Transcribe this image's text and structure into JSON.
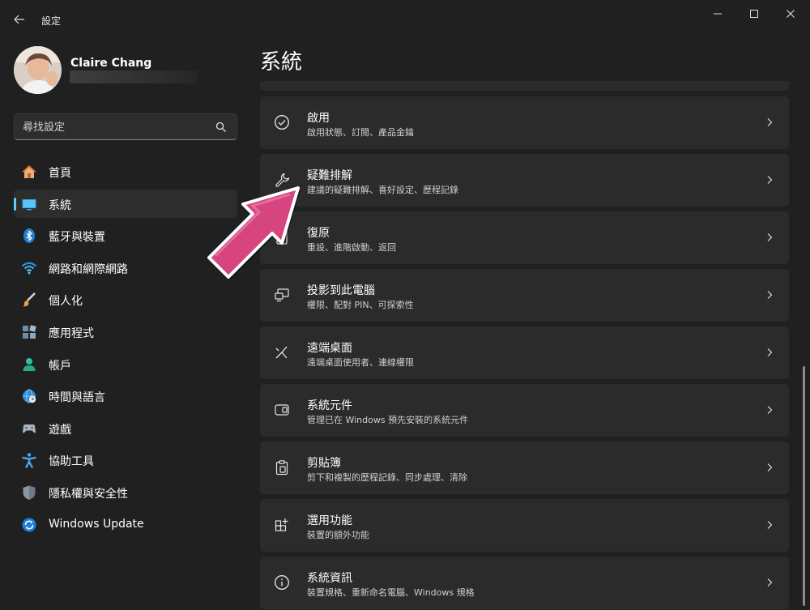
{
  "window": {
    "title": "設定",
    "controls": [
      "minimize-icon",
      "maximize-icon",
      "close-icon"
    ]
  },
  "profile": {
    "name": "Claire Chang"
  },
  "search": {
    "placeholder": "尋找設定"
  },
  "sidebar": {
    "items": [
      {
        "label": "首頁",
        "icon": "home-icon",
        "active": false
      },
      {
        "label": "系統",
        "icon": "monitor-icon",
        "active": true
      },
      {
        "label": "藍牙與裝置",
        "icon": "bluetooth-icon",
        "active": false
      },
      {
        "label": "網路和網際網路",
        "icon": "wifi-icon",
        "active": false
      },
      {
        "label": "個人化",
        "icon": "brush-icon",
        "active": false
      },
      {
        "label": "應用程式",
        "icon": "apps-icon",
        "active": false
      },
      {
        "label": "帳戶",
        "icon": "person-icon",
        "active": false
      },
      {
        "label": "時間與語言",
        "icon": "globe-clock-icon",
        "active": false
      },
      {
        "label": "遊戲",
        "icon": "gamepad-icon",
        "active": false
      },
      {
        "label": "協助工具",
        "icon": "accessibility-icon",
        "active": false
      },
      {
        "label": "隱私權與安全性",
        "icon": "shield-icon",
        "active": false
      },
      {
        "label": "Windows Update",
        "icon": "update-icon",
        "active": false
      }
    ]
  },
  "main": {
    "title": "系統",
    "cards": [
      {
        "title": "啟用",
        "desc": "啟用狀態、訂閱、產品金鑰",
        "icon": "check-circle-icon"
      },
      {
        "title": "疑難排解",
        "desc": "建議的疑難排解、喜好設定、歷程記錄",
        "icon": "wrench-icon"
      },
      {
        "title": "復原",
        "desc": "重設、進階啟動、返回",
        "icon": "recovery-icon"
      },
      {
        "title": "投影到此電腦",
        "desc": "權限、配對 PIN、可探索性",
        "icon": "project-icon"
      },
      {
        "title": "遠端桌面",
        "desc": "遠端桌面使用者、連線權限",
        "icon": "remote-desktop-icon"
      },
      {
        "title": "系統元件",
        "desc": "管理已在 Windows 預先安裝的系統元件",
        "icon": "components-icon"
      },
      {
        "title": "剪貼簿",
        "desc": "剪下和複製的歷程記錄、同步處理、清除",
        "icon": "clipboard-icon"
      },
      {
        "title": "選用功能",
        "desc": "裝置的額外功能",
        "icon": "optional-features-icon"
      },
      {
        "title": "系統資訊",
        "desc": "裝置規格、重新命名電腦、Windows 規格",
        "icon": "info-icon"
      }
    ]
  },
  "colors": {
    "background": "#202020",
    "card": "#2b2b2b",
    "accent": "#60cdff",
    "annotation_arrow": "#d6457f"
  }
}
